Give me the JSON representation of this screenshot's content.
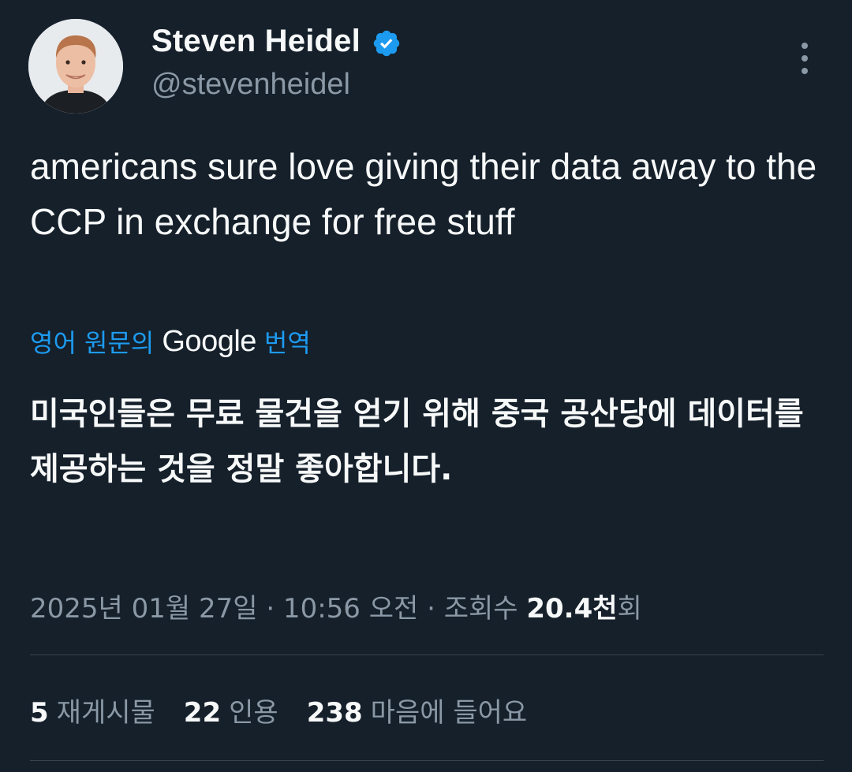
{
  "author": {
    "display_name": "Steven Heidel",
    "handle": "@stevenheidel",
    "verified": true
  },
  "tweet": {
    "text": "americans sure love giving their data away to the CCP in exchange for free stuff"
  },
  "translation": {
    "prefix": "영어 원문의",
    "provider": "Google",
    "suffix": "번역",
    "text": "미국인들은 무료 물건을 얻기 위해 중국 공산당에 데이터를 제공하는 것을 정말 좋아합니다."
  },
  "meta": {
    "timestamp": "2025년 01월 27일 · 10:56 오전 · 조회수 ",
    "views_count": "20.4천",
    "views_suffix": "회"
  },
  "stats": [
    {
      "count": "5",
      "label": "재게시물"
    },
    {
      "count": "22",
      "label": "인용"
    },
    {
      "count": "238",
      "label": "마음에 들어요"
    }
  ],
  "colors": {
    "background": "#15202b",
    "text": "#f7f9f9",
    "secondary": "#8b98a5",
    "accent": "#1d9bf0",
    "divider": "#38444d"
  },
  "icons": [
    "verified-badge-icon",
    "more-options-icon"
  ]
}
